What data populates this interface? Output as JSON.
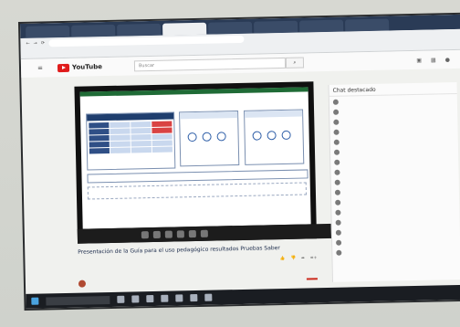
{
  "browser": {
    "tabs": [
      "",
      "",
      "",
      "",
      "",
      "",
      "",
      ""
    ],
    "url": ""
  },
  "youtube": {
    "logo_text": "YouTube",
    "search_placeholder": "Buscar"
  },
  "video": {
    "title": "Presentación de la Guía para el uso pedagógico resultados Pruebas Saber",
    "views": ""
  },
  "chat": {
    "header": "Chat destacado",
    "messages": [
      "",
      "",
      "",
      "",
      "",
      "",
      "",
      "",
      "",
      "",
      "",
      "",
      "",
      "",
      "",
      "",
      "",
      ""
    ]
  }
}
